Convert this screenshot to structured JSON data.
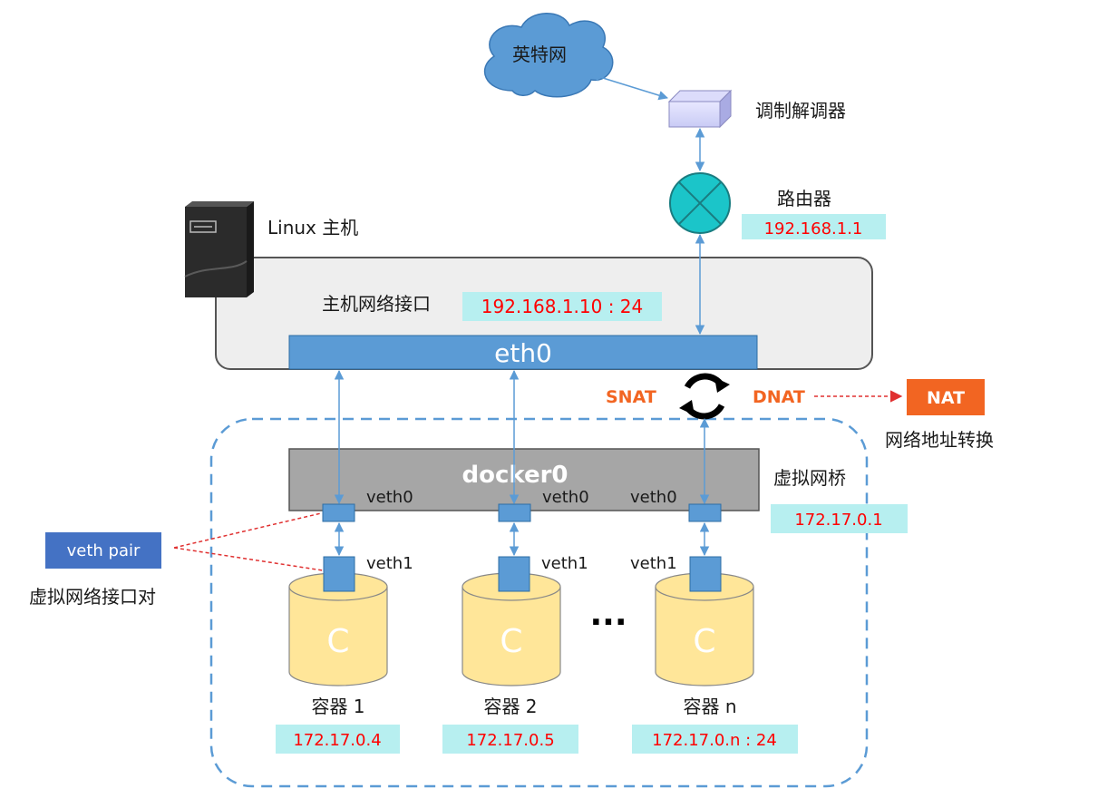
{
  "internet": {
    "label": "英特网"
  },
  "modem": {
    "label": "调制解调器"
  },
  "router": {
    "label": "路由器",
    "ip": "192.168.1.1"
  },
  "host": {
    "label": "Linux 主机",
    "nic_label": "主机网络接口",
    "nic_ip": "192.168.1.10 : 24",
    "eth_label": "eth0"
  },
  "nat": {
    "snat": "SNAT",
    "dnat": "DNAT",
    "box_label": "NAT",
    "caption": "网络地址转换"
  },
  "bridge": {
    "label": "docker0",
    "caption": "虚拟网桥",
    "ip": "172.17.0.1"
  },
  "veth_pair": {
    "label": "veth pair",
    "caption": "虚拟网络接口对"
  },
  "containers": [
    {
      "veth0": "veth0",
      "veth1": "veth1",
      "glyph": "C",
      "name": "容器 1",
      "ip": "172.17.0.4"
    },
    {
      "veth0": "veth0",
      "veth1": "veth1",
      "glyph": "C",
      "name": "容器 2",
      "ip": "172.17.0.5"
    },
    {
      "veth0": "veth0",
      "veth1": "veth1",
      "glyph": "C",
      "name": "容器 n",
      "ip": "172.17.0.n : 24"
    }
  ],
  "ellipsis": "···",
  "colors": {
    "accent_blue": "#5b9bd5",
    "ip_text": "#ff0000",
    "ip_bg": "#b7eff0",
    "nat_orange": "#f26522",
    "cloud": "#5b9bd5",
    "container_fill": "#ffe699",
    "bridge_fill": "#a6a6a6"
  }
}
